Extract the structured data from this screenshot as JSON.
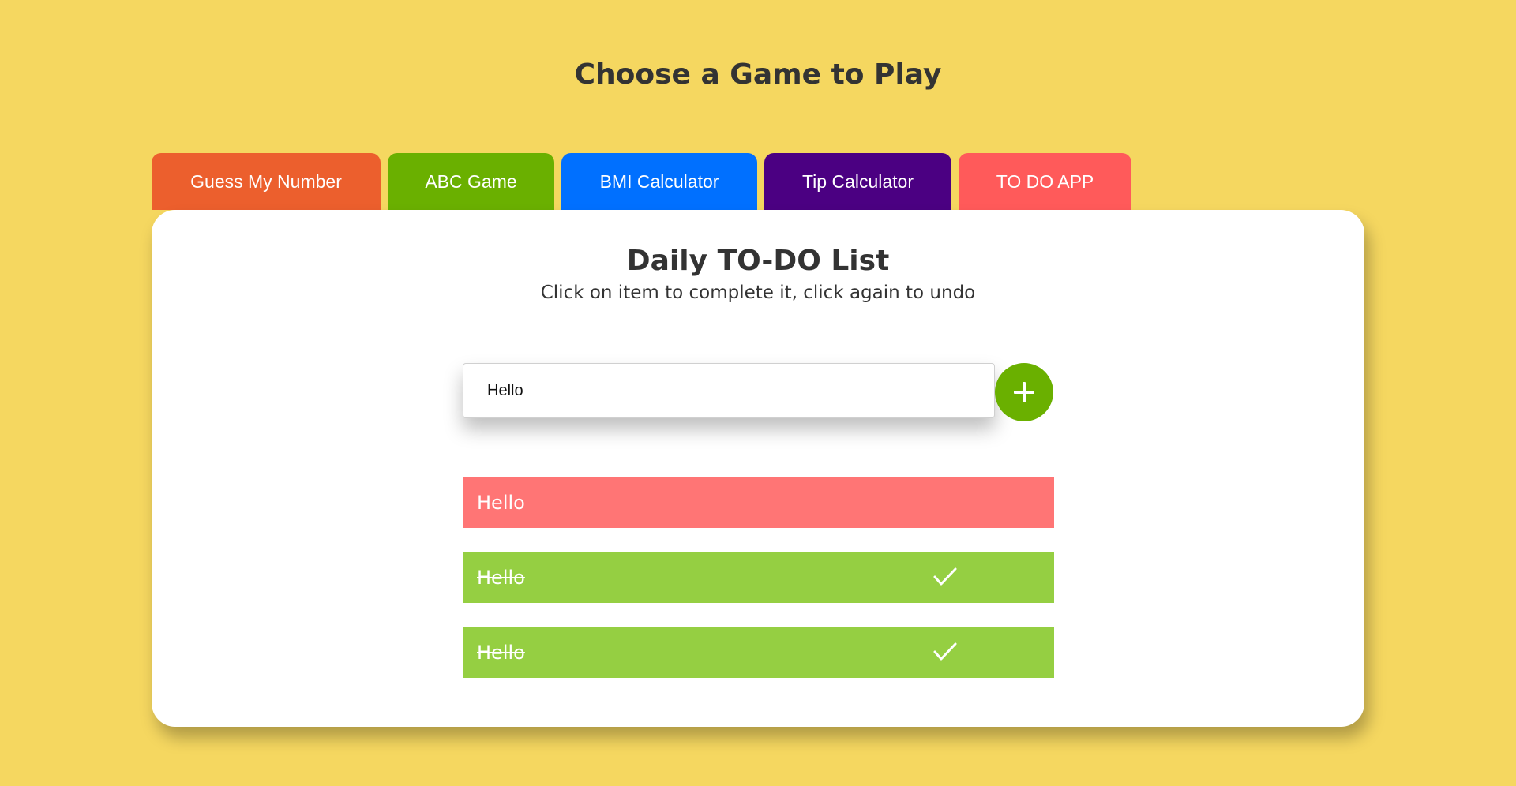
{
  "page": {
    "title": "Choose a Game to Play"
  },
  "tabs": [
    {
      "label": "Guess My Number",
      "color": "#ec5f2d"
    },
    {
      "label": "ABC Game",
      "color": "#6ab000"
    },
    {
      "label": "BMI Calculator",
      "color": "#0070ff"
    },
    {
      "label": "Tip Calculator",
      "color": "#4b0082"
    },
    {
      "label": "TO DO APP",
      "color": "#ff5a5a"
    }
  ],
  "todo": {
    "title": "Daily TO-DO List",
    "subtitle": "Click on item to complete it, click again to undo",
    "input_value": "Hello",
    "add_button_icon": "plus-icon",
    "items": [
      {
        "text": "Hello",
        "completed": false
      },
      {
        "text": "Hello",
        "completed": true
      },
      {
        "text": "Hello",
        "completed": true
      }
    ]
  },
  "colors": {
    "background": "#f5d760",
    "card": "#ffffff",
    "pending_item": "#ff7575",
    "completed_item": "#95cf42",
    "add_button": "#6ab000"
  }
}
